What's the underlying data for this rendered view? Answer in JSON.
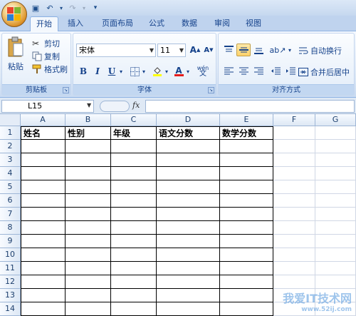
{
  "colors": {
    "accent": "#15428b",
    "ribbon": "#dbe7f6",
    "selected": "#ffd26a"
  },
  "qat": [
    {
      "name": "save-icon",
      "glyph": "💾"
    },
    {
      "name": "undo-icon",
      "glyph": "↶"
    },
    {
      "name": "redo-icon",
      "glyph": "↷"
    },
    {
      "name": "customize-icon",
      "glyph": "▾"
    }
  ],
  "tabs": [
    "开始",
    "插入",
    "页面布局",
    "公式",
    "数据",
    "审阅",
    "视图"
  ],
  "clipboard": {
    "paste": "粘贴",
    "cut": "剪切",
    "copy": "复制",
    "format_painter": "格式刷",
    "label": "剪贴板"
  },
  "font": {
    "name": "宋体",
    "size": "11",
    "grow": "A",
    "shrink": "A",
    "bold": "B",
    "italic": "I",
    "underline": "U",
    "label": "字体",
    "phonetic": "wén"
  },
  "alignment": {
    "wrap_text": "自动换行",
    "merge_center": "合并后居中",
    "label": "对齐方式"
  },
  "formula_bar": {
    "name_box": "L15",
    "fx": "fx",
    "value": ""
  },
  "columns": [
    "A",
    "B",
    "C",
    "D",
    "E",
    "F",
    "G"
  ],
  "rows": [
    "1",
    "2",
    "3",
    "4",
    "5",
    "6",
    "7",
    "8",
    "9",
    "10",
    "11",
    "12",
    "13",
    "14"
  ],
  "header_row": [
    "姓名",
    "性别",
    "年级",
    "语文分数",
    "数学分数"
  ],
  "watermark": {
    "main": "我爱IT技术网",
    "sub": "www.52ij.com"
  }
}
